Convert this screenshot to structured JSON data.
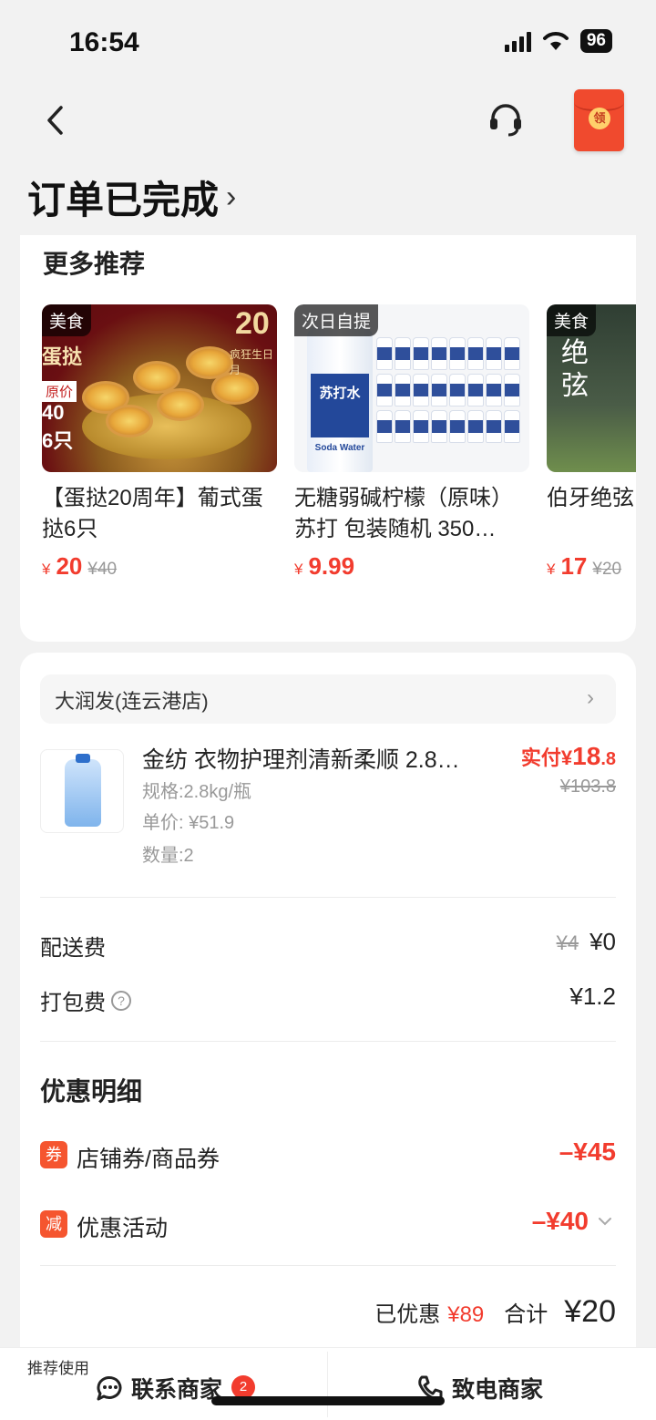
{
  "status_bar": {
    "time": "16:54",
    "battery": "96"
  },
  "nav": {
    "redpacket_label": "领"
  },
  "page_title": "订单已完成",
  "recommend": {
    "title": "更多推荐",
    "items": [
      {
        "tag": "美食",
        "name": "【蛋挞20周年】葡式蛋挞6只",
        "currency": "¥",
        "price": "20",
        "original": "¥40"
      },
      {
        "tag": "次日自提",
        "name": "无糖弱碱柠檬（原味）苏打 包装随机 350…",
        "currency": "¥",
        "price": "9.99",
        "original": ""
      },
      {
        "tag": "美食",
        "name": "伯牙绝弦",
        "currency": "¥",
        "price": "17",
        "original": "¥20"
      }
    ]
  },
  "order": {
    "store_name": "大润发(连云港店)",
    "product": {
      "name": "金纺 衣物护理剂清新柔顺 2.8…",
      "spec": "规格:2.8kg/瓶",
      "unit_price": "单价: ¥51.9",
      "quantity": "数量:2",
      "paid_label": "实付¥",
      "paid_int": "18",
      "paid_dec": ".8",
      "original_price": "¥103.8"
    },
    "fees": [
      {
        "label": "配送费",
        "original": "¥4",
        "value": "¥0"
      },
      {
        "label": "打包费",
        "value": "¥1.2"
      }
    ],
    "discount_title": "优惠明细",
    "discounts": [
      {
        "badge": "券",
        "label": "店铺券/商品券",
        "value": "–¥45"
      },
      {
        "badge": "减",
        "label": "优惠活动",
        "value": "–¥40"
      }
    ],
    "total": {
      "saved_label": "已优惠",
      "saved_value": "¥89",
      "label": "合计",
      "amount": "¥20"
    }
  },
  "bottom_bar": {
    "hint": "推荐使用",
    "contact_label": "联系商家",
    "unread_count": "2",
    "call_label": "致电商家"
  },
  "colors": {
    "accent": "#f23c2e",
    "background": "#f2f2f2"
  },
  "icons": [
    "back-icon",
    "customer-service-icon",
    "red-packet-icon",
    "chevron-right-icon",
    "help-icon",
    "chevron-down-icon",
    "chat-icon",
    "phone-icon"
  ]
}
